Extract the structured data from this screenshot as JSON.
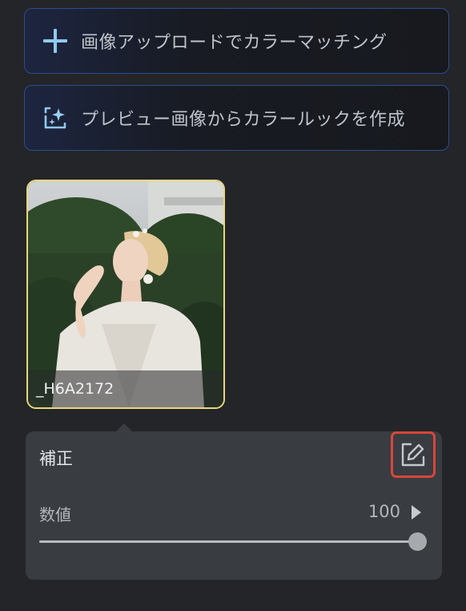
{
  "buttons": {
    "upload_match": {
      "label": "画像アップロードでカラーマッチング",
      "icon": "plus-icon"
    },
    "create_look": {
      "label": "プレビュー画像からカラールックを作成",
      "icon": "sparkle-frame-icon"
    }
  },
  "thumbnail": {
    "caption": "_H6A2172"
  },
  "panel": {
    "title": "補正",
    "edit_icon": "edit-icon",
    "slider": {
      "label": "数値",
      "value_text": "100",
      "value": 100,
      "max": 100
    }
  },
  "colors": {
    "accent_border": "#2c4d8f",
    "selected_border": "#e9d77a",
    "highlight_red": "#d9463a"
  }
}
